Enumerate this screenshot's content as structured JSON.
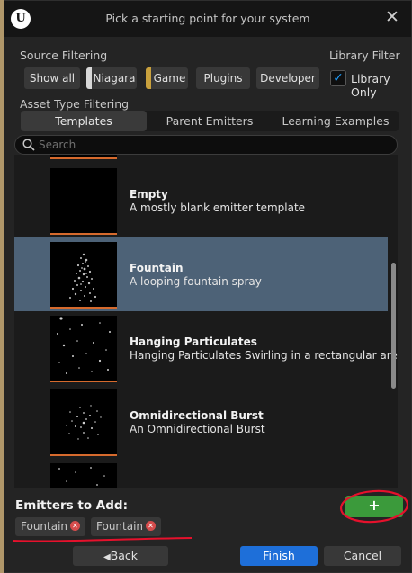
{
  "window": {
    "logo_text": "U",
    "title": "Pick a starting point for your system",
    "close_glyph": "✕"
  },
  "source_filtering": {
    "label": "Source Filtering",
    "buttons": [
      {
        "label": "Show all",
        "color": null
      },
      {
        "label": "Niagara",
        "color": "#d8d8d8"
      },
      {
        "label": "Game",
        "color": "#c9a13d"
      },
      {
        "label": "Plugins",
        "color": null
      },
      {
        "label": "Developer",
        "color": null
      }
    ]
  },
  "library_filter": {
    "label": "Library Filter",
    "checkbox_label": "Library Only",
    "checked": true,
    "check_glyph": "✓"
  },
  "asset_type": {
    "label": "Asset Type Filtering",
    "tabs": [
      "Templates",
      "Parent Emitters",
      "Learning Examples"
    ],
    "active_tab": "Templates"
  },
  "search": {
    "placeholder": "Search",
    "value": ""
  },
  "templates": [
    {
      "name": "Empty",
      "description": "A mostly blank emitter template",
      "selected": false
    },
    {
      "name": "Fountain",
      "description": "A looping fountain spray",
      "selected": true
    },
    {
      "name": "Hanging Particulates",
      "description": "Hanging Particulates Swirling in a rectangular area",
      "selected": false
    },
    {
      "name": "Omnidirectional Burst",
      "description": "An Omnidirectional Burst",
      "selected": false
    }
  ],
  "emitters_to_add": {
    "label": "Emitters to Add:",
    "add_glyph": "+",
    "remove_glyph": "✕",
    "items": [
      "Fountain",
      "Fountain"
    ]
  },
  "footer": {
    "back_label": "Back",
    "back_glyph": "◀",
    "finish_label": "Finish",
    "cancel_label": "Cancel"
  },
  "colors": {
    "selection": "#4d6277",
    "accent_blue": "#1e6fd9",
    "add_green": "#3b9a3b",
    "annotation_red": "#e6112c",
    "thumb_border": "#d66a2d"
  }
}
